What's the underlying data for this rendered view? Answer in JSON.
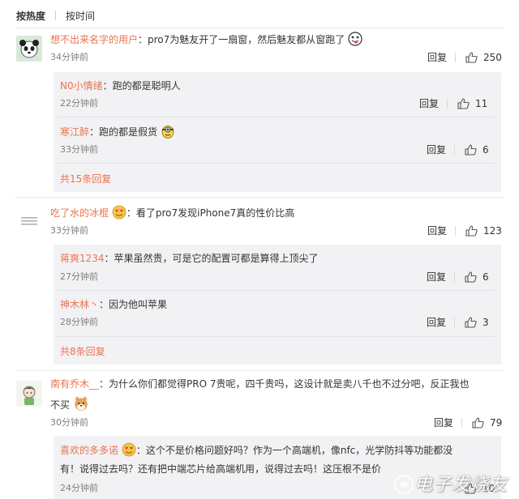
{
  "sort": {
    "hot": "按热度",
    "time": "按时间"
  },
  "reply_label": "回复",
  "comments": [
    {
      "user": "想不出来名字的用户",
      "text": "：pro7为魅友开了一扇窗，然后魅友都从窗跑了",
      "time": "34分钟前",
      "likes": "250",
      "replies": [
        {
          "user": "N0小情绪",
          "text": "：跑的都是聪明人",
          "time": "22分钟前",
          "likes": "11"
        },
        {
          "user": "寒江醉",
          "text": "：跑的都是假货",
          "time": "33分钟前",
          "likes": "6"
        }
      ],
      "more": "共15条回复"
    },
    {
      "user": "吃了水的冰棍",
      "text": "：看了pro7发现iPhone7真的性价比高",
      "time": "33分钟前",
      "likes": "123",
      "replies": [
        {
          "user": "蒋爽1234",
          "text": "：苹果虽然贵，可是它的配置可都是算得上顶尖了",
          "time": "27分钟前",
          "likes": "6"
        },
        {
          "user": "神木林丶",
          "text": "：因为他叫苹果",
          "time": "28分钟前",
          "likes": "3"
        }
      ],
      "more": "共8条回复"
    },
    {
      "user": "南有乔木__",
      "text": "：为什么你们都觉得PRO 7贵呢，四千贵吗，这设计就是卖八千也不过分吧，反正我也",
      "text2": "不买",
      "time": "30分钟前",
      "likes": "79",
      "replies": [
        {
          "user": "喜欢的多多诺",
          "text": "：这个不是价格问题好吗？作为一个高端机，像nfc，光学防抖等功能都没",
          "text2": "有！说得过去吗？还有把中端芯片给高端机用，说得过去吗！这压根不是价",
          "time": "24分钟前",
          "likes": "10"
        }
      ]
    }
  ],
  "watermark": "电子发烧友",
  "colors": {
    "username": "#eb7350",
    "subbox": "#f2f2f5",
    "text": "#333333",
    "meta": "#808080"
  }
}
